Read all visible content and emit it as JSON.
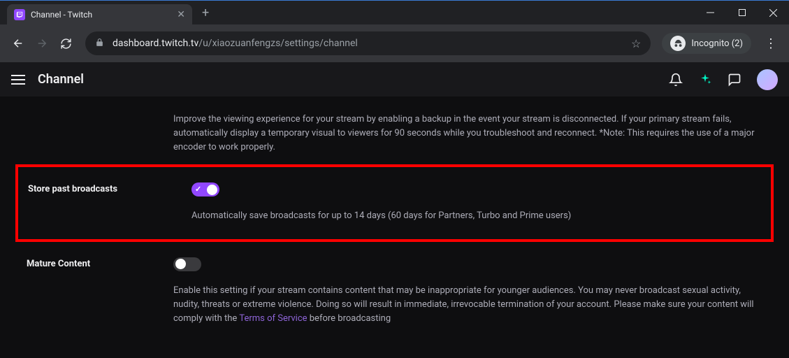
{
  "browser": {
    "tab": {
      "title": "Channel - Twitch"
    },
    "address": {
      "host": "dashboard.twitch.tv",
      "path": "/u/xiaozuanfengzs/settings/channel"
    },
    "incognito": {
      "label": "Incognito (2)"
    }
  },
  "twitch": {
    "header": {
      "title": "Channel"
    },
    "settings": {
      "backup": {
        "desc": "Improve the viewing experience for your stream by enabling a backup in the event your stream is disconnected. If your primary stream fails, automatically display a temporary visual to viewers for 90 seconds while you troubleshoot and reconnect. *Note: This requires the use of a major encoder to work properly."
      },
      "store_past": {
        "label": "Store past broadcasts",
        "desc": "Automatically save broadcasts for up to 14 days (60 days for Partners, Turbo and Prime users)",
        "enabled": true
      },
      "mature": {
        "label": "Mature Content",
        "desc_pre": "Enable this setting if your stream contains content that may be inappropriate for younger audiences. You may never broadcast sexual activity, nudity, threats or extreme violence. Doing so will result in immediate, irrevocable termination of your account. Please make sure your content will comply with the ",
        "tos_link": "Terms of Service",
        "desc_post": " before broadcasting",
        "enabled": false
      }
    }
  }
}
